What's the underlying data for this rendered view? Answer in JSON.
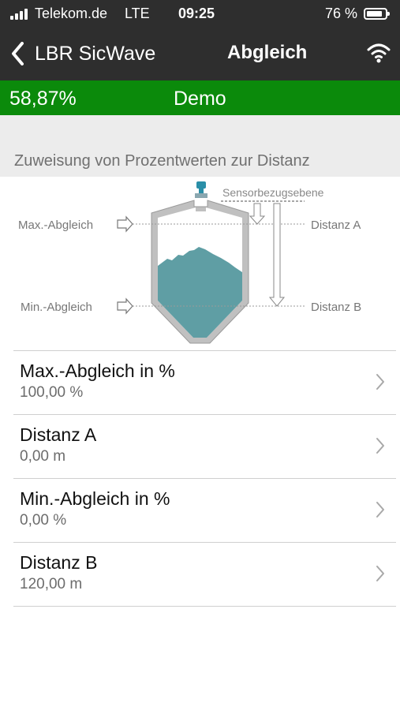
{
  "status_bar": {
    "carrier": "Telekom.de",
    "network": "LTE",
    "time": "09:25",
    "battery_percent": "76 %",
    "battery_level": 0.76
  },
  "nav": {
    "back_label": "LBR SicWave",
    "title": "Abgleich"
  },
  "value_bar": {
    "percent": "58,87%",
    "mode": "Demo",
    "color": "#0b8a0b"
  },
  "section": {
    "title": "Zuweisung von Prozentwerten zur Distanz"
  },
  "diagram": {
    "sensor_label": "Sensorbezugsebene",
    "max_label": "Max.-Abgleich",
    "min_label": "Min.-Abgleich",
    "distance_a_label": "Distanz A",
    "distance_b_label": "Distanz B",
    "product_color": "#5f9ea4"
  },
  "list": [
    {
      "title": "Max.-Abgleich in %",
      "value": "100,00 %"
    },
    {
      "title": "Distanz A",
      "value": "0,00 m"
    },
    {
      "title": "Min.-Abgleich in %",
      "value": "0,00 %"
    },
    {
      "title": "Distanz B",
      "value": "120,00 m"
    }
  ],
  "icons": {
    "back": "chevron-left-icon",
    "wifi": "wifi-icon",
    "row": "chevron-right-icon",
    "sensor": "radar-sensor-icon"
  }
}
